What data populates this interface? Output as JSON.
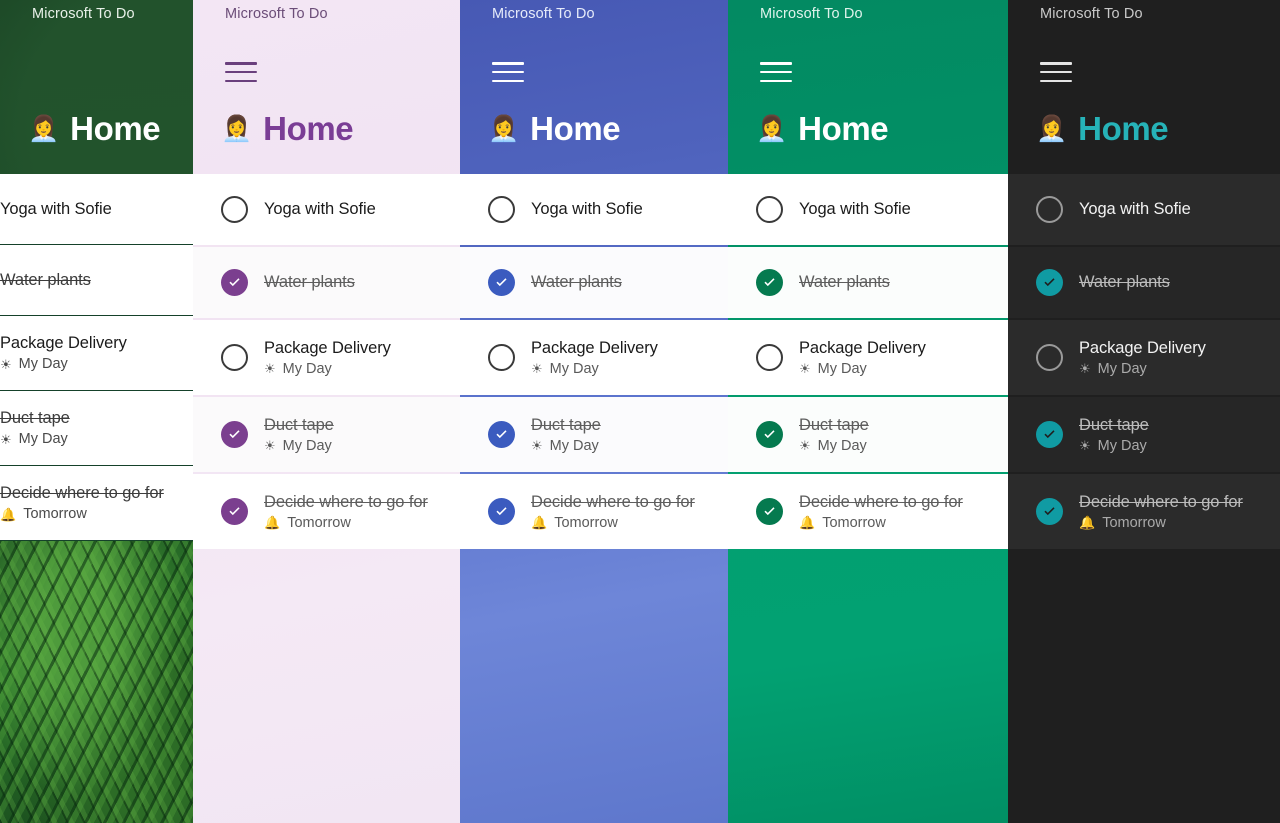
{
  "app": {
    "name": "Microsoft To Do"
  },
  "list": {
    "emoji": "👩‍💼",
    "title": "Home"
  },
  "icons": {
    "hamburger": "hamburger-menu-icon",
    "my_day": "☀",
    "reminder": "🔔",
    "checkmark": "check-icon"
  },
  "tasks": [
    {
      "title": "Yoga with Sofie",
      "completed": false,
      "meta": "",
      "meta_icon": ""
    },
    {
      "title": "Water plants",
      "completed": true,
      "meta": "",
      "meta_icon": ""
    },
    {
      "title": "Package Delivery",
      "completed": false,
      "meta": "My Day",
      "meta_icon": "☀"
    },
    {
      "title": "Duct tape",
      "completed": true,
      "meta": "My Day",
      "meta_icon": "☀"
    },
    {
      "title": "Decide where to go for",
      "completed": true,
      "meta": "Tomorrow",
      "meta_icon": "🔔"
    }
  ],
  "panels": [
    {
      "id": "panel-photo",
      "theme_name": "photo-fern-dark-green",
      "accent": "#1d5421",
      "title_color": "#ffffff"
    },
    {
      "id": "panel-light",
      "theme_name": "light-lavender-purple",
      "accent": "#7b3f8f",
      "title_color": "#7a3d95"
    },
    {
      "id": "panel-blue",
      "theme_name": "blue",
      "accent": "#3b5bbf",
      "title_color": "#ffffff"
    },
    {
      "id": "panel-green",
      "theme_name": "green",
      "accent": "#057a4f",
      "title_color": "#ffffff"
    },
    {
      "id": "panel-dark",
      "theme_name": "dark-teal",
      "accent": "#109ba3",
      "title_color": "#26b3b8"
    }
  ]
}
